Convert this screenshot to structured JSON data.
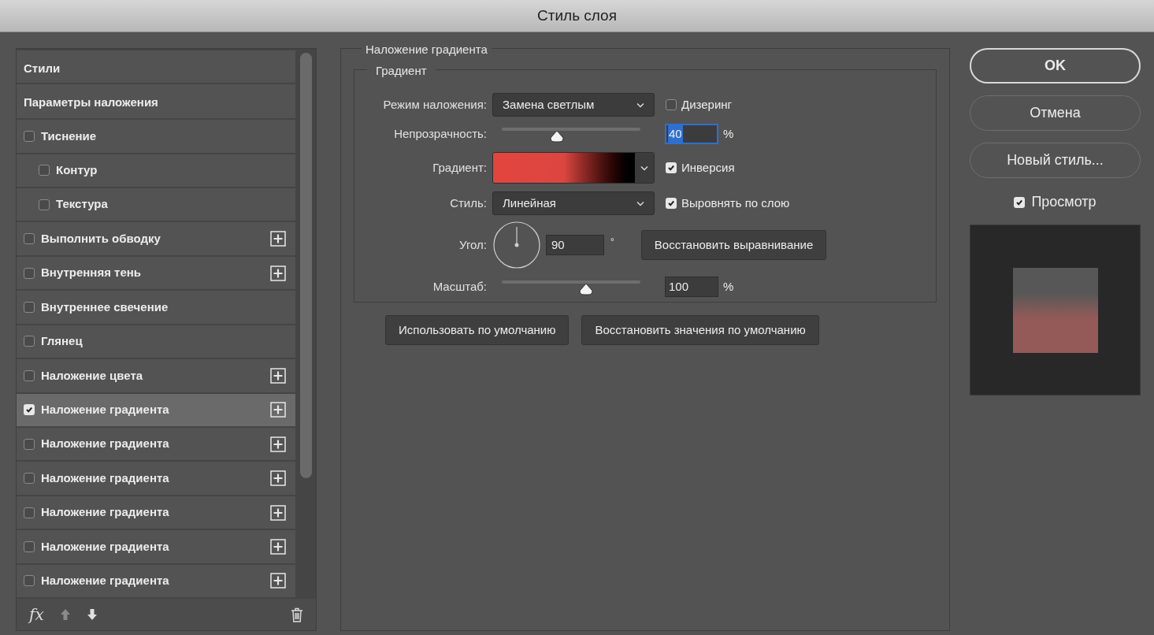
{
  "window": {
    "title": "Стиль слоя"
  },
  "sidebar": {
    "items": [
      {
        "kind": "header",
        "label": "Стили",
        "selected": false
      },
      {
        "kind": "header",
        "label": "Параметры наложения",
        "selected": false
      },
      {
        "kind": "effect",
        "label": "Тиснение",
        "checked": false,
        "selected": false,
        "add_button": false,
        "children": [
          {
            "label": "Контур",
            "checked": false,
            "selected": false
          },
          {
            "label": "Текстура",
            "checked": false,
            "selected": false
          }
        ]
      },
      {
        "kind": "effect",
        "label": "Выполнить обводку",
        "checked": false,
        "selected": false,
        "add_button": true
      },
      {
        "kind": "effect",
        "label": "Внутренняя тень",
        "checked": false,
        "selected": false,
        "add_button": true
      },
      {
        "kind": "effect",
        "label": "Внутреннее свечение",
        "checked": false,
        "selected": false,
        "add_button": false
      },
      {
        "kind": "effect",
        "label": "Глянец",
        "checked": false,
        "selected": false,
        "add_button": false
      },
      {
        "kind": "effect",
        "label": "Наложение цвета",
        "checked": false,
        "selected": false,
        "add_button": true
      },
      {
        "kind": "effect",
        "label": "Наложение градиента",
        "checked": true,
        "selected": true,
        "add_button": true
      },
      {
        "kind": "effect",
        "label": "Наложение градиента",
        "checked": false,
        "selected": false,
        "add_button": true
      },
      {
        "kind": "effect",
        "label": "Наложение градиента",
        "checked": false,
        "selected": false,
        "add_button": true
      },
      {
        "kind": "effect",
        "label": "Наложение градиента",
        "checked": false,
        "selected": false,
        "add_button": true
      },
      {
        "kind": "effect",
        "label": "Наложение градиента",
        "checked": false,
        "selected": false,
        "add_button": true
      },
      {
        "kind": "effect",
        "label": "Наложение градиента",
        "checked": false,
        "selected": false,
        "add_button": true
      }
    ],
    "footer": {
      "fx_label": "fx"
    }
  },
  "panel": {
    "section_title": "Наложение градиента",
    "group_title": "Градиент",
    "blend_mode": {
      "label": "Режим наложения:",
      "value": "Замена светлым"
    },
    "dither": {
      "label": "Дизеринг",
      "checked": false
    },
    "opacity": {
      "label": "Непрозрачность:",
      "level": 0.4,
      "value": "40",
      "unit": "%"
    },
    "gradient": {
      "label": "Градиент:"
    },
    "reverse": {
      "label": "Инверсия",
      "checked": true
    },
    "style": {
      "label": "Стиль:",
      "value": "Линейная"
    },
    "align": {
      "label": "Выровнять по слою",
      "checked": true
    },
    "angle": {
      "label": "Угол:",
      "value": "90",
      "unit": "°"
    },
    "reset_alignment": "Восстановить выравнивание",
    "scale": {
      "label": "Масштаб:",
      "level": 0.61,
      "value": "100",
      "unit": "%"
    },
    "buttons": [
      "Использовать по умолчанию",
      "Восстановить значения по умолчанию"
    ]
  },
  "actions": [
    {
      "label": "OK",
      "kind": "primary"
    },
    {
      "label": "Отмена",
      "kind": "secondary"
    },
    {
      "label": "Новый стиль...",
      "kind": "secondary"
    }
  ],
  "preview": {
    "label": "Просмотр",
    "checked": true
  }
}
